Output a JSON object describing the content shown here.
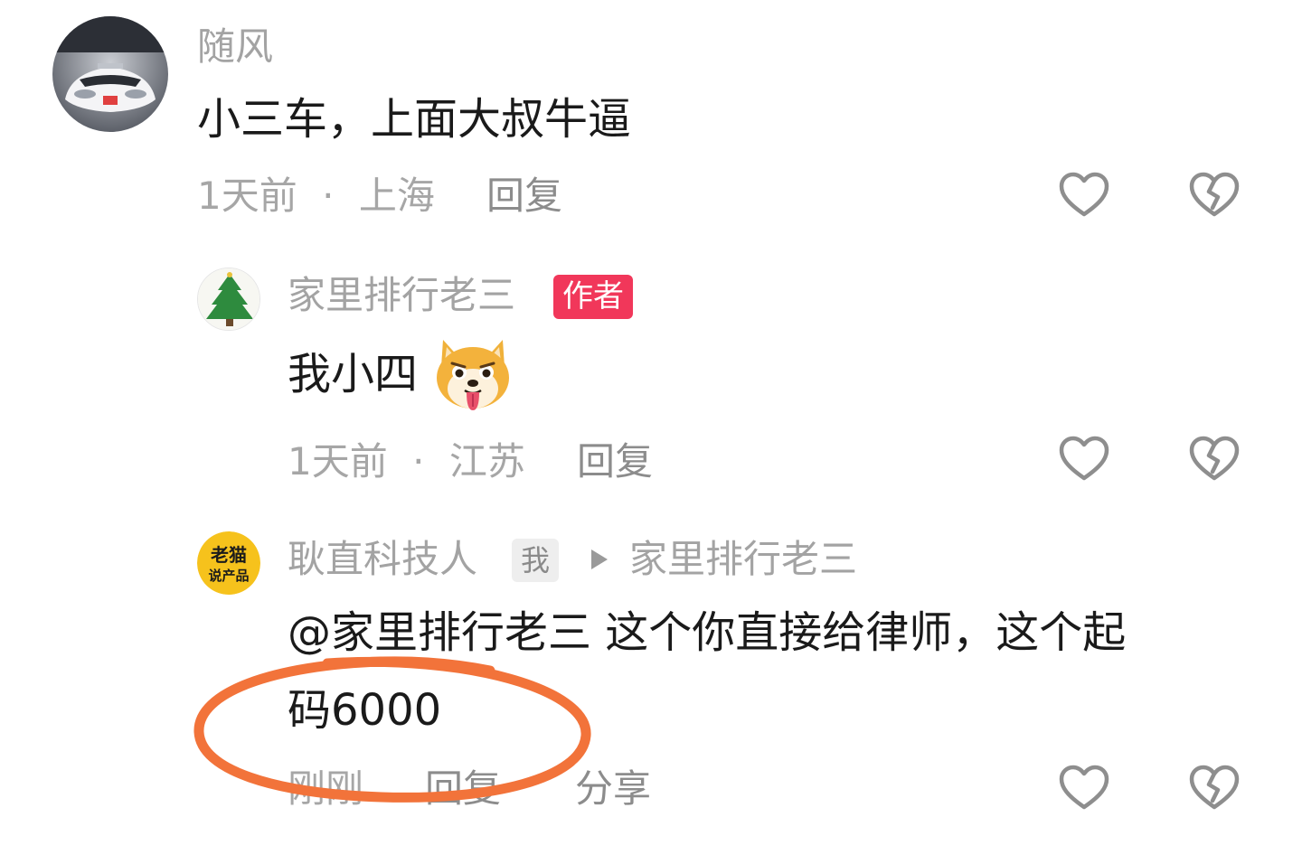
{
  "comments": [
    {
      "username": "随风",
      "content": "小三车，上面大叔牛逼",
      "time": "1天前",
      "location": "上海",
      "separator": "·",
      "reply_label": "回复"
    },
    {
      "username": "家里排行老三",
      "badge": "作者",
      "content": "我小四",
      "time": "1天前",
      "location": "江苏",
      "separator": "·",
      "reply_label": "回复"
    },
    {
      "username": "耿直科技人",
      "me_badge": "我",
      "reply_to": "家里排行老三",
      "content_line1": "@家里排行老三 这个你直接给律师，这个起",
      "content_line2": "码6000",
      "time": "刚刚",
      "reply_label": "回复",
      "share_label": "分享"
    }
  ],
  "avatars": {
    "avatar3_line1": "老猫",
    "avatar3_line2": "说产品"
  },
  "colors": {
    "author_badge": "#f1375a",
    "highlight_circle": "#f2733a",
    "meta_text": "#a6a6a6"
  },
  "icons": [
    "heart-icon",
    "broken-heart-icon",
    "triangle-right-icon"
  ]
}
